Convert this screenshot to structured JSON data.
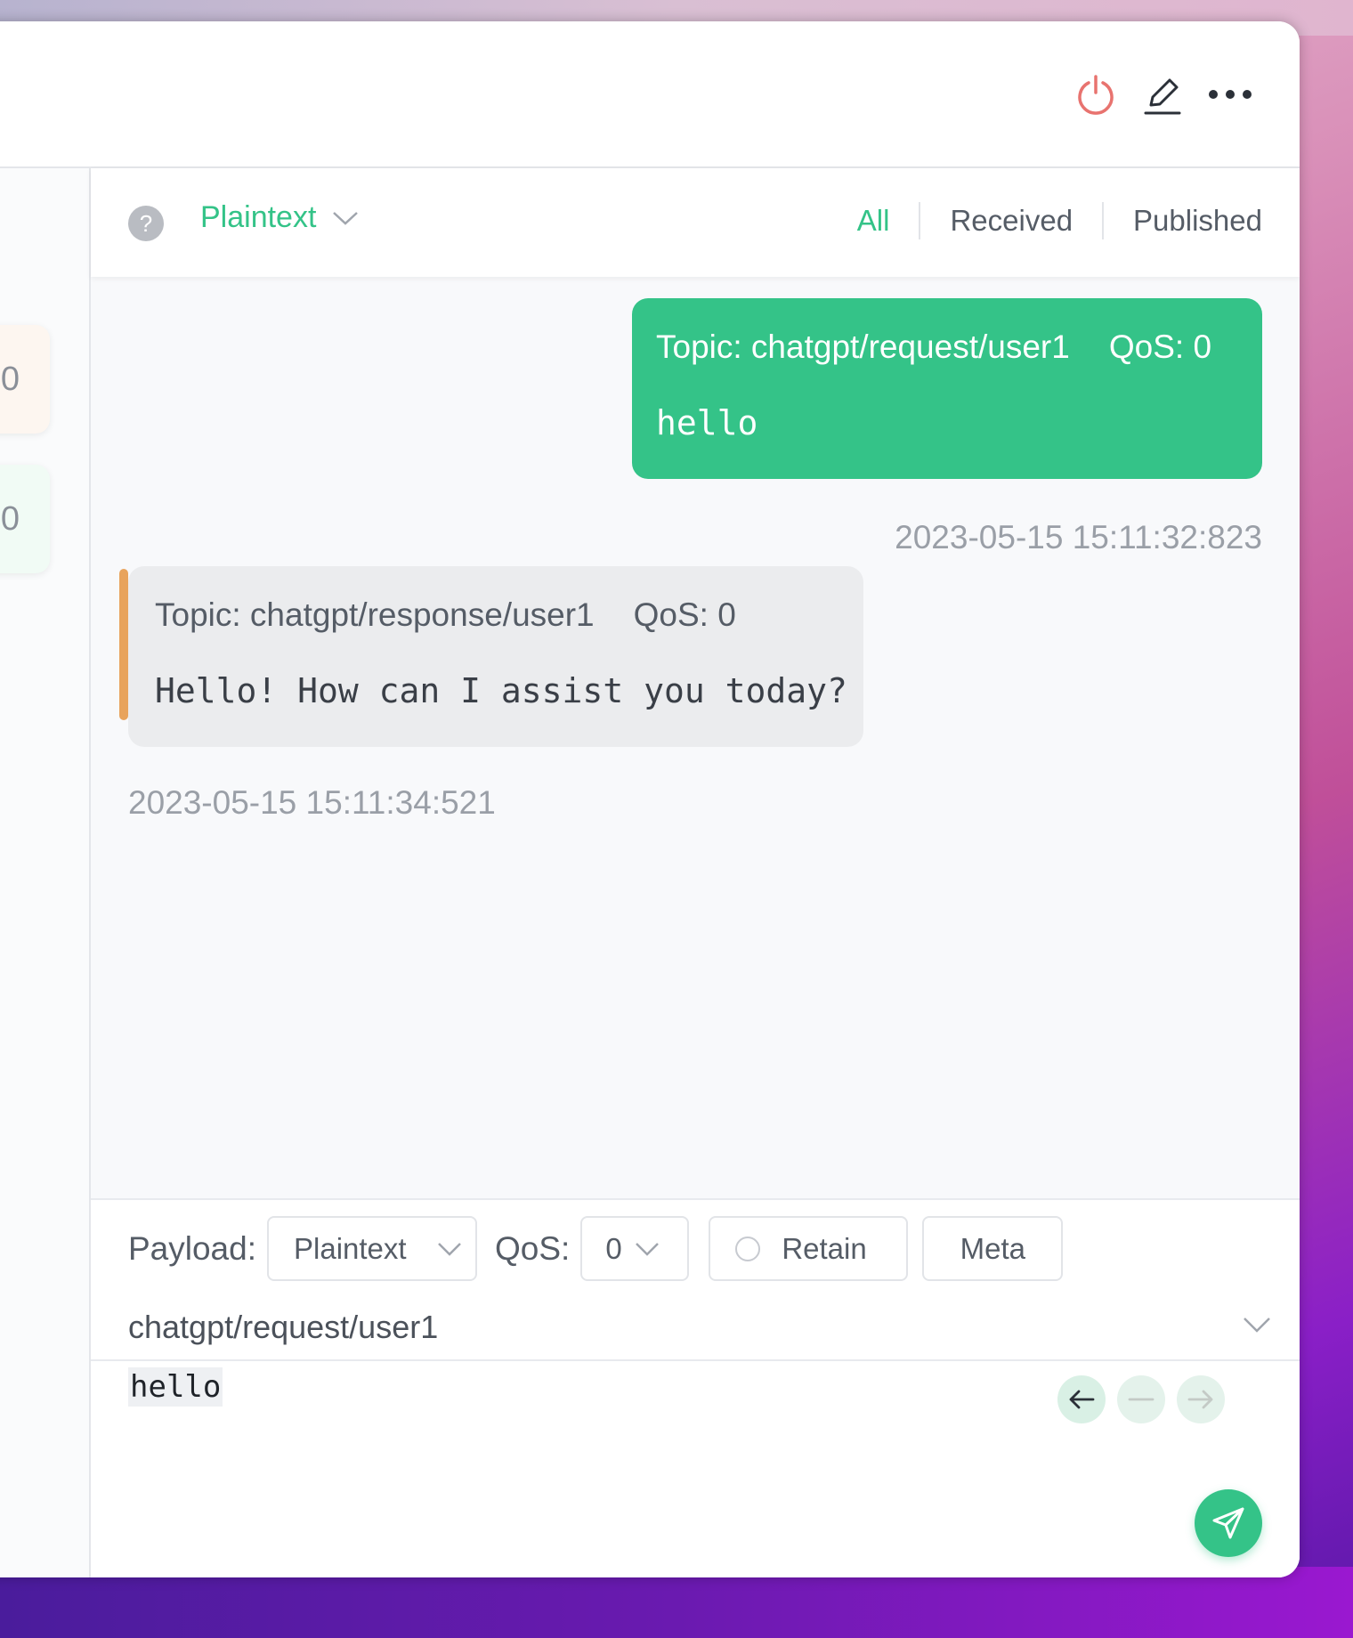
{
  "toolbar": {
    "disconnect_icon": "power-icon",
    "edit_icon": "pencil-icon",
    "more_icon": "ellipsis-icon"
  },
  "stats": [
    {
      "value": "0",
      "tint": "#fdf6f0"
    },
    {
      "value": "0",
      "tint": "#f1fbf5"
    }
  ],
  "filter": {
    "help": "?",
    "format": "Plaintext",
    "tabs": [
      {
        "label": "All",
        "active": true
      },
      {
        "label": "Received",
        "active": false
      },
      {
        "label": "Published",
        "active": false
      }
    ]
  },
  "messages": [
    {
      "direction": "published",
      "topic": "Topic: chatgpt/request/user1",
      "qos": "QoS: 0",
      "payload": "hello",
      "time": "2023-05-15 15:11:32:823"
    },
    {
      "direction": "received",
      "topic": "Topic: chatgpt/response/user1",
      "qos": "QoS: 0",
      "payload": "Hello! How can I assist you today?",
      "time": "2023-05-15 15:11:34:521"
    }
  ],
  "publisher": {
    "payload_label": "Payload:",
    "payload_format": "Plaintext",
    "qos_label": "QoS:",
    "qos_value": "0",
    "retain_label": "Retain",
    "meta_label": "Meta",
    "topic": "chatgpt/request/user1",
    "payload": "hello"
  },
  "colors": {
    "accent": "#34c388",
    "disconnect": "#e8736f",
    "received_bar": "#e8a35c"
  }
}
